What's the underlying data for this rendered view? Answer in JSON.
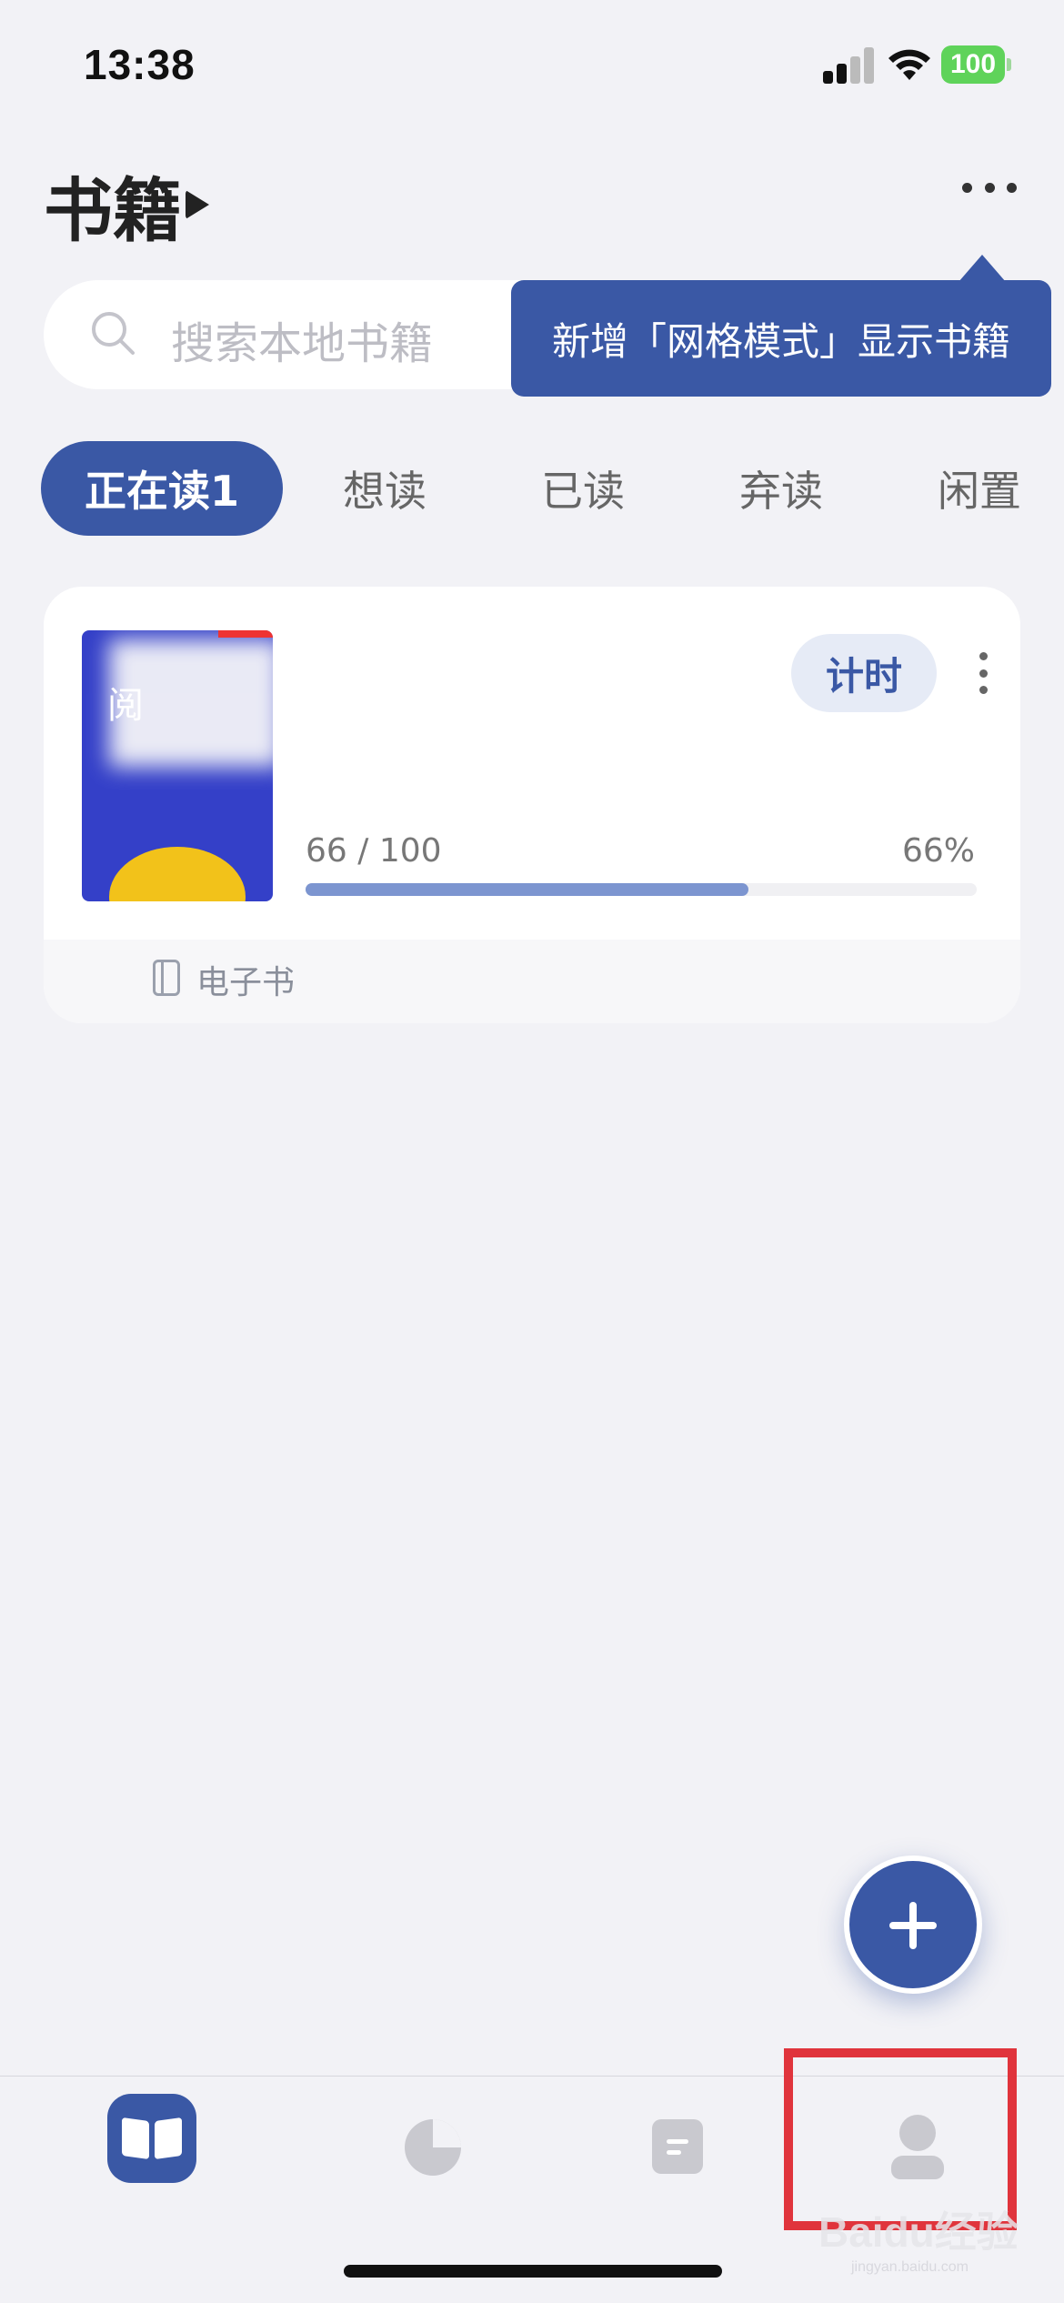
{
  "status_bar": {
    "time": "13:38",
    "battery": "100"
  },
  "header": {
    "title": "书籍"
  },
  "search": {
    "placeholder": "搜索本地书籍"
  },
  "tooltip": {
    "text": "新增「网格模式」显示书籍"
  },
  "tabs": [
    {
      "label": "正在读1",
      "active": true
    },
    {
      "label": "想读"
    },
    {
      "label": "已读"
    },
    {
      "label": "弃读"
    },
    {
      "label": "闲置"
    }
  ],
  "book": {
    "cover_char": "阅",
    "timer_label": "计时",
    "progress_text": "66 / 100",
    "progress_percent": "66%",
    "progress_value": 0.66,
    "format_label": "电子书"
  },
  "tab_bar": {
    "items": [
      "books",
      "stats",
      "notes",
      "me"
    ]
  },
  "watermark": {
    "text": "Baidu经验",
    "sub": "jingyan.baidu.com"
  },
  "colors": {
    "accent": "#3a58a5",
    "highlight": "#e0343c",
    "progress": "#7c95d0"
  }
}
